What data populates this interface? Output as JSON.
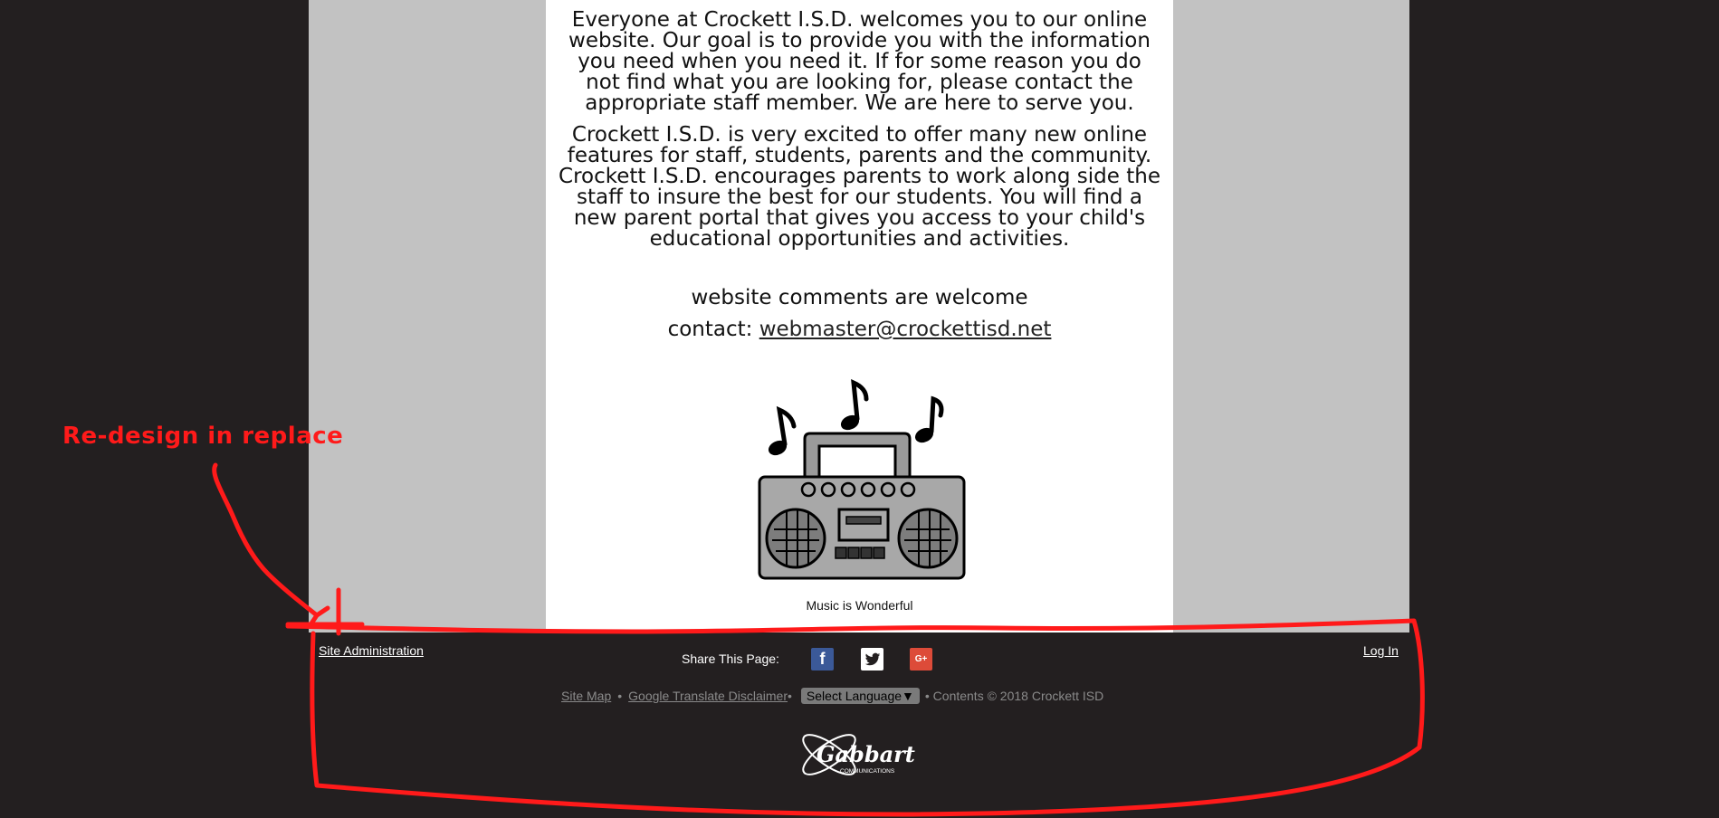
{
  "content": {
    "paragraph1": "Everyone at Crockett I.S.D. welcomes you to our online website.  Our goal is to provide you with the information you need when you need it. If for some reason you do not find what you are looking for, please contact the appropriate staff member. We are here to serve you.",
    "paragraph2": "Crockett I.S.D. is very excited to offer many new online features for staff, students, parents and the community. Crockett I.S.D. encourages parents to work along side the staff to insure the best for our students. You will find a new parent portal that gives you access to your child's educational opportunities and activities.",
    "comments_line": "website comments are welcome",
    "contact_label": "contact:",
    "contact_email": "webmaster@crockettisd.net",
    "image_icon": "boombox-music-icon",
    "image_caption": "Music is Wonderful"
  },
  "footer": {
    "site_admin_label": "Site Administration",
    "login_label": "Log In",
    "share_label": "Share This Page:",
    "social": [
      {
        "icon": "facebook-icon",
        "glyph": "f"
      },
      {
        "icon": "twitter-icon",
        "glyph": ""
      },
      {
        "icon": "google-plus-icon",
        "glyph": "G+"
      }
    ],
    "site_map_label": "Site Map",
    "translate_disclaimer_label": "Google Translate Disclaimer",
    "language_select_value": "Select Language▼",
    "separator": "•",
    "copyright": "• Contents © 2018 Crockett ISD",
    "logo_text": "Gabbart",
    "logo_subtext": "COMMUNICATIONS"
  },
  "annotation": {
    "note_text": "Re-design in replace",
    "color": "#ff1a1a"
  },
  "colors": {
    "page_background": "#231f20",
    "gray_panel": "#c2c2c2",
    "content_background": "#ffffff",
    "facebook": "#3b5998",
    "google_plus": "#dd4b39"
  }
}
